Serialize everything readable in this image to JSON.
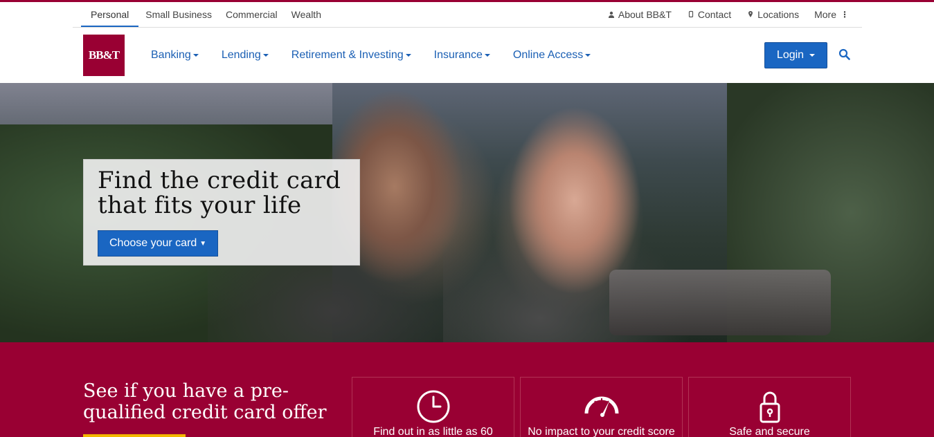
{
  "brand": {
    "logo_text": "BB&T",
    "primary_color": "#990033",
    "accent_blue": "#1a66c2",
    "highlight_yellow": "#f2b700"
  },
  "utility": {
    "segments": [
      "Personal",
      "Small Business",
      "Commercial",
      "Wealth"
    ],
    "active_segment": "Personal",
    "links": [
      {
        "label": "About BB&T",
        "icon": "person-icon"
      },
      {
        "label": "Contact",
        "icon": "phone-icon"
      },
      {
        "label": "Locations",
        "icon": "location-pin-icon"
      },
      {
        "label": "More",
        "icon": "more-vertical-icon"
      }
    ]
  },
  "nav": {
    "items": [
      "Banking",
      "Lending",
      "Retirement & Investing",
      "Insurance",
      "Online Access"
    ],
    "login_label": "Login",
    "search_icon": "search-icon"
  },
  "hero": {
    "title": "Find the credit card that fits your life",
    "button_label": "Choose your card"
  },
  "offer": {
    "title": "See if you have a pre-qualified credit card offer",
    "features": [
      {
        "icon": "clock-icon",
        "text": "Find out in as little as 60"
      },
      {
        "icon": "speedometer-icon",
        "text": "No impact to your credit score"
      },
      {
        "icon": "padlock-icon",
        "text": "Safe and secure"
      }
    ]
  }
}
